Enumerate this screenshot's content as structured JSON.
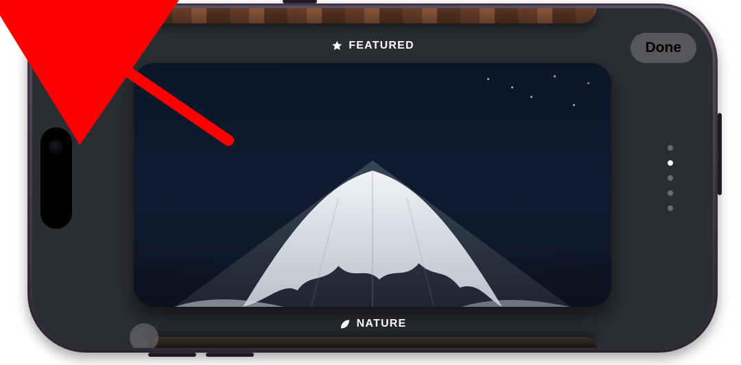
{
  "buttons": {
    "add": "+",
    "done": "Done"
  },
  "sections": {
    "featured": "FEATURED",
    "nature": "NATURE"
  },
  "icons": {
    "star": "star-icon",
    "leaf": "leaf-icon",
    "plus": "plus-icon"
  },
  "colors": {
    "accent_arrow": "#ff0000"
  },
  "page_indicator": {
    "count": 5,
    "active_index": 1
  },
  "annotation": {
    "target": "add-button"
  }
}
